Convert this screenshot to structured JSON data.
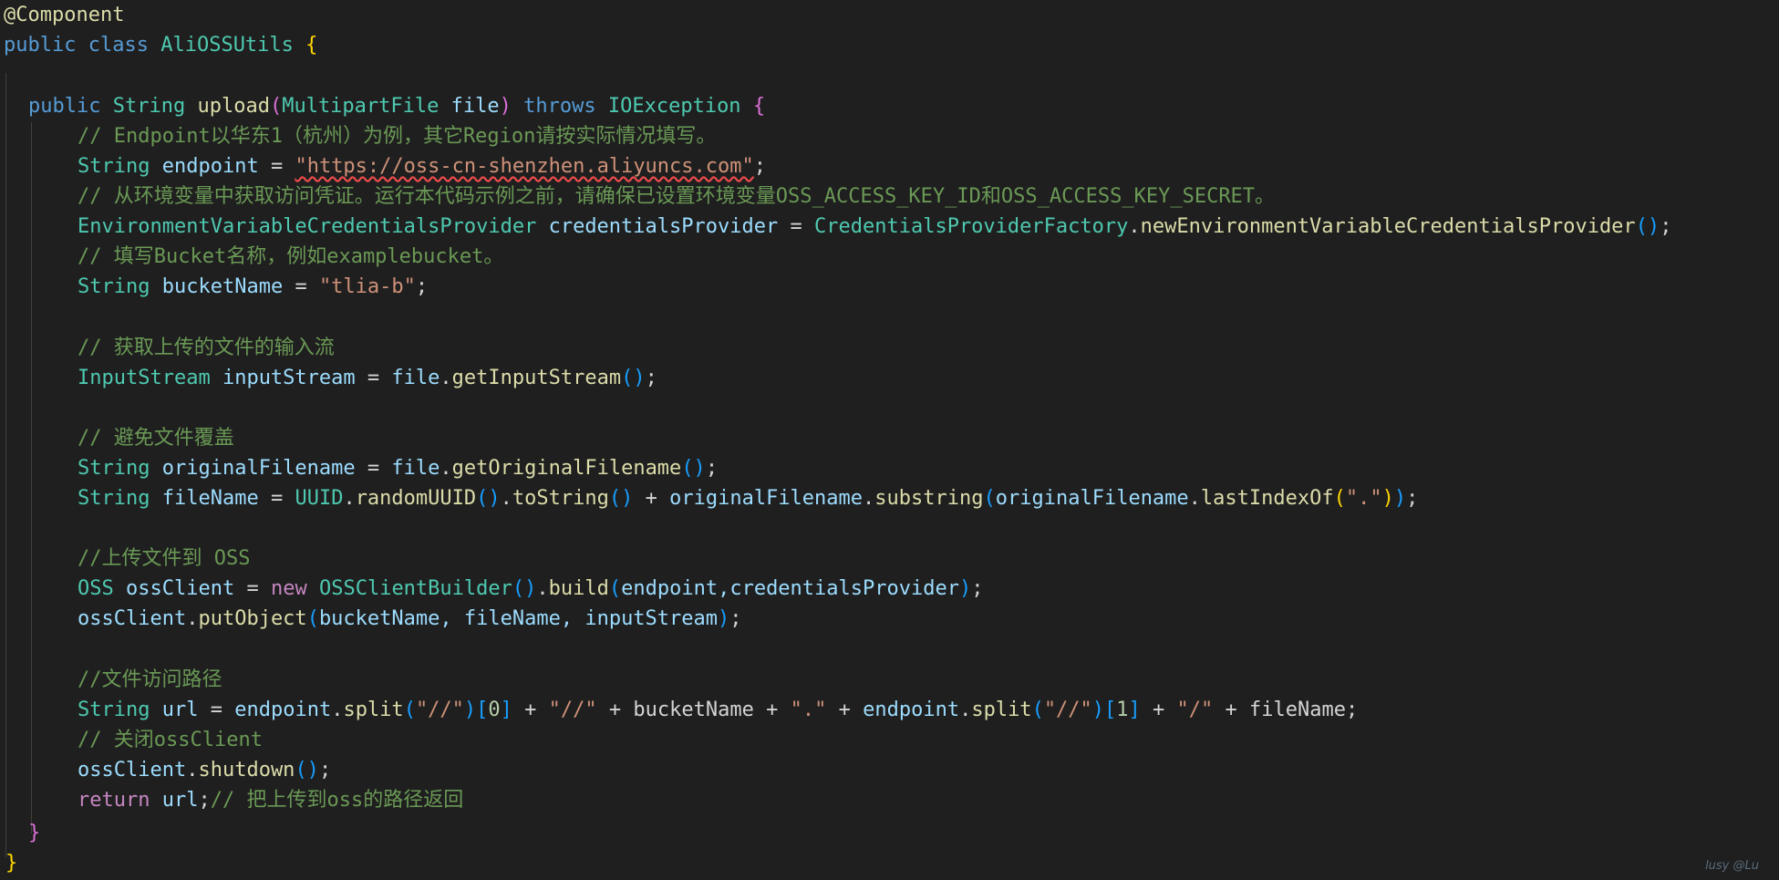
{
  "code": {
    "annotation": "@Component",
    "class_kw_public": "public",
    "class_kw_class": "class",
    "class_name": "AliOSSUtils",
    "open_brace": "{",
    "method_public": "public",
    "method_return": "String",
    "method_name": "upload",
    "param_type": "MultipartFile",
    "param_name": "file",
    "throws_kw": "throws",
    "exception": "IOException",
    "comment1": "// Endpoint以华东1（杭州）为例，其它Region请按实际情况填写。",
    "endpoint_type": "String",
    "endpoint_var": "endpoint",
    "endpoint_value": "\"https://oss-cn-shenzhen.aliyuncs.com\"",
    "comment2": "// 从环境变量中获取访问凭证。运行本代码示例之前，请确保已设置环境变量OSS_ACCESS_KEY_ID和OSS_ACCESS_KEY_SECRET。",
    "cred_type": "EnvironmentVariableCredentialsProvider",
    "cred_var": "credentialsProvider",
    "cred_factory": "CredentialsProviderFactory",
    "cred_method": "newEnvironmentVariableCredentialsProvider",
    "comment3": "// 填写Bucket名称，例如examplebucket。",
    "bucket_type": "String",
    "bucket_var": "bucketName",
    "bucket_value": "\"tlia-b\"",
    "comment4": "// 获取上传的文件的输入流",
    "is_type": "InputStream",
    "is_var": "inputStream",
    "is_obj": "file",
    "is_method": "getInputStream",
    "comment5": "// 避免文件覆盖",
    "of_type": "String",
    "of_var": "originalFilename",
    "of_obj": "file",
    "of_method": "getOriginalFilename",
    "fn_type": "String",
    "fn_var": "fileName",
    "uuid_class": "UUID",
    "uuid_method": "randomUUID",
    "tostring_method": "toString",
    "of_ref": "originalFilename",
    "substring_method": "substring",
    "lastindex_method": "lastIndexOf",
    "dot_str": "\".\"",
    "comment6": "//上传文件到 OSS",
    "oss_type": "OSS",
    "oss_var": "ossClient",
    "new_kw": "new",
    "builder_class": "OSSClientBuilder",
    "build_method": "build",
    "build_args": "endpoint,credentialsProvider",
    "put_obj": "ossClient",
    "put_method": "putObject",
    "put_args": "bucketName, fileName, inputStream",
    "comment7": "//文件访问路径",
    "url_type": "String",
    "url_var": "url",
    "split_method": "split",
    "slash_str": "\"//\"",
    "idx0": "0",
    "idx1": "1",
    "dot_str2": "\".\"",
    "slash1_str": "\"/\"",
    "bucket_ref": "bucketName",
    "filename_ref": "fileName",
    "endpoint_ref": "endpoint",
    "comment8": "// 关闭ossClient",
    "shutdown_obj": "ossClient",
    "shutdown_method": "shutdown",
    "return_kw": "return",
    "return_var": "url",
    "comment9": "// 把上传到oss的路径返回",
    "close_brace": "}"
  },
  "watermark": "lusy @Lu",
  "colors": {
    "background": "#1f1f1f",
    "keyword": "#569cd6",
    "type": "#4ec9b0",
    "function": "#dcdcaa",
    "variable": "#9cdcfe",
    "string": "#ce9178",
    "comment": "#6a9955"
  }
}
